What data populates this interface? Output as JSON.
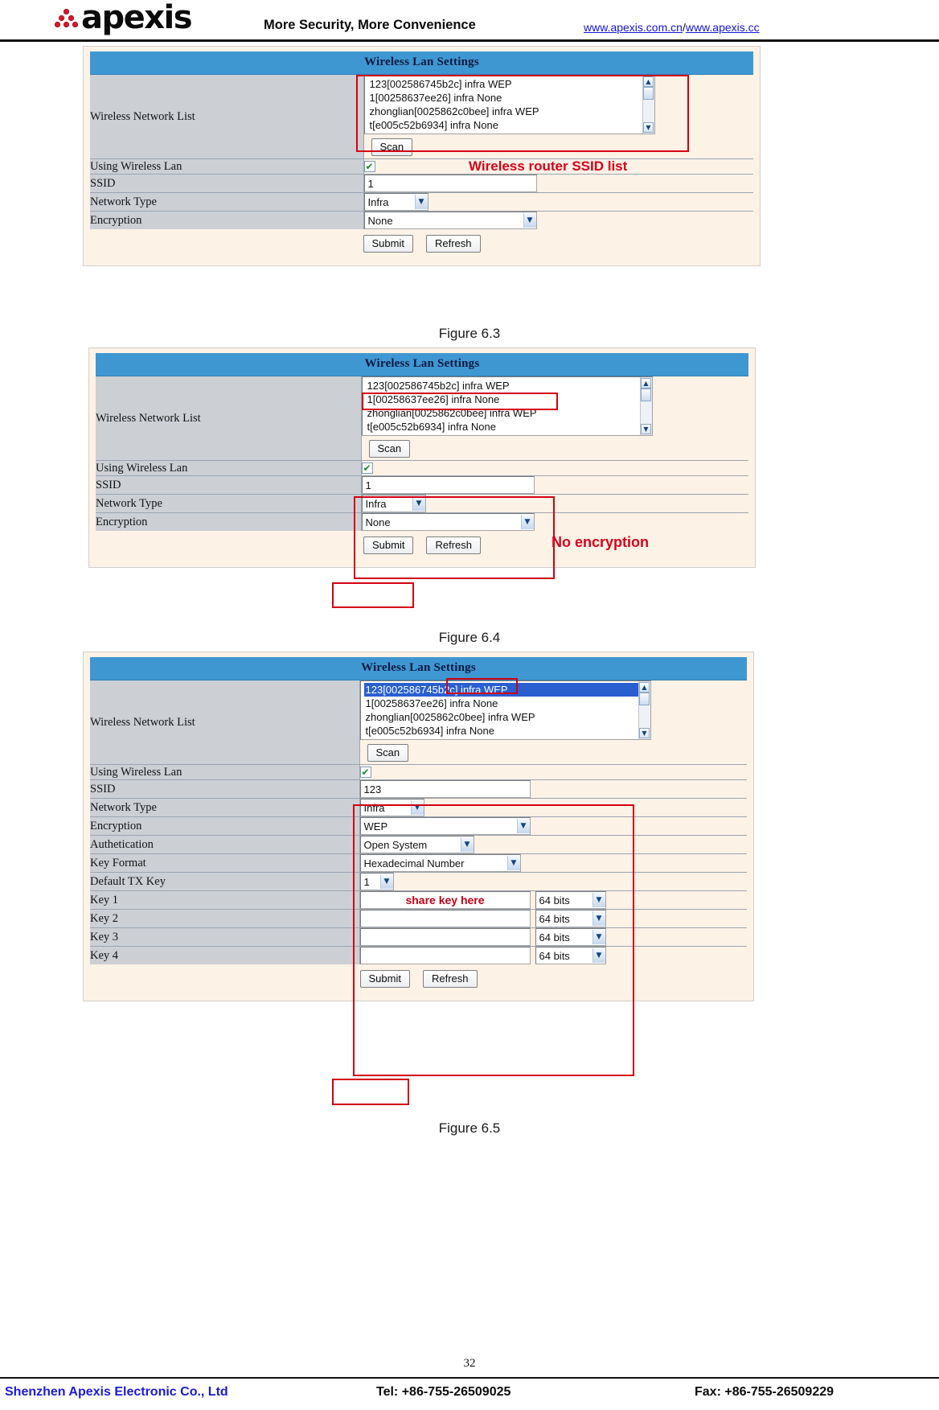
{
  "header": {
    "logo_text": "apexis",
    "logo_icon": "apexis-dots-logo",
    "tagline": "More Security, More Convenience",
    "link1": "www.apexis.com.cn",
    "separator": "/",
    "link2": "www.apexis.cc"
  },
  "figures": [
    {
      "id": "fig63",
      "caption": "Figure 6.3",
      "panel_title": "Wireless Lan Settings",
      "network_list_label": "Wireless Network List",
      "networks": [
        {
          "text": "123[002586745b2c] infra WEP",
          "selected": false
        },
        {
          "text": "1[00258637ee26] infra None",
          "selected": false
        },
        {
          "text": "zhonglian[0025862c0bee] infra WEP",
          "selected": false
        },
        {
          "text": "t[e005c52b6934] infra None",
          "selected": false
        }
      ],
      "scan_label": "Scan",
      "annotation": "Wireless router SSID list",
      "rows": [
        {
          "label": "Using Wireless Lan",
          "type": "checkbox",
          "checked": true
        },
        {
          "label": "SSID",
          "type": "text",
          "value": "1"
        },
        {
          "label": "Network Type",
          "type": "select",
          "value": "Infra"
        },
        {
          "label": "Encryption",
          "type": "select",
          "value": "None"
        }
      ],
      "submit_label": "Submit",
      "refresh_label": "Refresh"
    },
    {
      "id": "fig64",
      "caption": "Figure 6.4",
      "panel_title": "Wireless Lan Settings",
      "network_list_label": "Wireless Network List",
      "networks": [
        {
          "text": "123[002586745b2c] infra WEP",
          "selected": false
        },
        {
          "text": "1[00258637ee26] infra None",
          "selected": false
        },
        {
          "text": "zhonglian[0025862c0bee] infra WEP",
          "selected": false
        },
        {
          "text": "t[e005c52b6934] infra None",
          "selected": false
        }
      ],
      "scan_label": "Scan",
      "annotation": "No encryption",
      "rows": [
        {
          "label": "Using Wireless Lan",
          "type": "checkbox",
          "checked": true
        },
        {
          "label": "SSID",
          "type": "text",
          "value": "1"
        },
        {
          "label": "Network Type",
          "type": "select",
          "value": "Infra"
        },
        {
          "label": "Encryption",
          "type": "select",
          "value": "None"
        }
      ],
      "submit_label": "Submit",
      "refresh_label": "Refresh"
    },
    {
      "id": "fig65",
      "caption": "Figure 6.5",
      "panel_title": "Wireless Lan Settings",
      "network_list_label": "Wireless Network List",
      "networks": [
        {
          "text": "123[002586745b2c] infra WEP",
          "selected": true
        },
        {
          "text": "1[00258637ee26] infra None",
          "selected": false
        },
        {
          "text": "zhonglian[0025862c0bee] infra WEP",
          "selected": false
        },
        {
          "text": "t[e005c52b6934] infra None",
          "selected": false
        }
      ],
      "scan_label": "Scan",
      "rows": [
        {
          "label": "Using Wireless Lan",
          "type": "checkbox",
          "checked": true
        },
        {
          "label": "SSID",
          "type": "text",
          "value": "123"
        },
        {
          "label": "Network Type",
          "type": "select",
          "value": "Infra"
        },
        {
          "label": "Encryption",
          "type": "select",
          "value": "WEP"
        },
        {
          "label": "Authetication",
          "type": "select",
          "value": "Open System"
        },
        {
          "label": "Key Format",
          "type": "select",
          "value": "Hexadecimal Number"
        },
        {
          "label": "Default TX Key",
          "type": "select",
          "value": "1"
        },
        {
          "label": "Key 1",
          "type": "key",
          "value": "share key here",
          "bits": "64 bits"
        },
        {
          "label": "Key 2",
          "type": "key",
          "value": "",
          "bits": "64 bits"
        },
        {
          "label": "Key 3",
          "type": "key",
          "value": "",
          "bits": "64 bits"
        },
        {
          "label": "Key 4",
          "type": "key",
          "value": "",
          "bits": "64 bits"
        }
      ],
      "submit_label": "Submit",
      "refresh_label": "Refresh"
    }
  ],
  "footer": {
    "page_number": "32",
    "company": "Shenzhen Apexis Electronic Co., Ltd",
    "tel": "Tel: +86-755-26509025",
    "fax": "Fax: +86-755-26509229"
  },
  "colors": {
    "panel_bg": "#fdf2e6",
    "title_bar": "#3f97d2",
    "label_bg": "#ccd0d5",
    "annotation_red": "#d8001a",
    "link_blue": "#1414dd",
    "selection_blue": "#2a5fd0"
  }
}
